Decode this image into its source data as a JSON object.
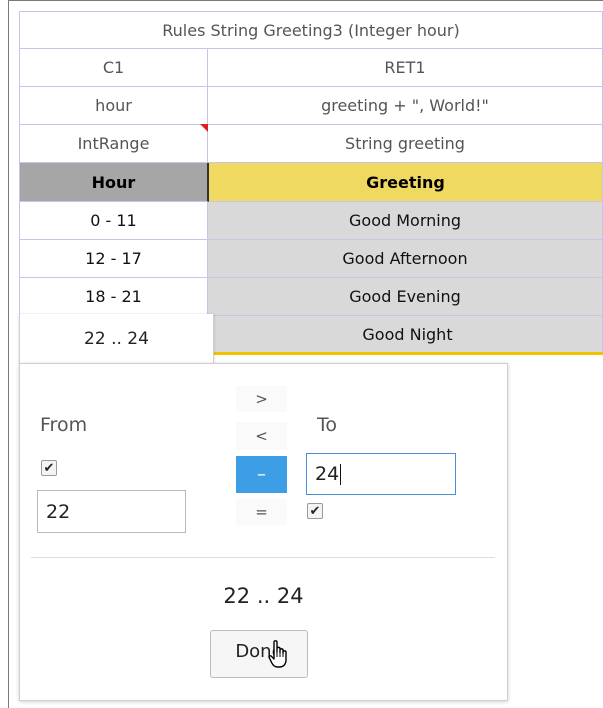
{
  "table": {
    "title": "Rules String Greeting3 (Integer hour)",
    "columns": [
      {
        "id": "C1",
        "param": "hour",
        "type": "IntRange",
        "header": "Hour"
      },
      {
        "id": "RET1",
        "param": "greeting + \", World!\"",
        "type": "String greeting",
        "header": "Greeting"
      }
    ],
    "rows": [
      {
        "condition": "0 - 11",
        "value": "Good Morning"
      },
      {
        "condition": "12 - 17",
        "value": "Good Afternoon"
      },
      {
        "condition": "18 - 21",
        "value": "Good Evening"
      },
      {
        "condition": "22 .. 24",
        "value": "Good Night"
      }
    ]
  },
  "range_editor": {
    "from_label": "From",
    "to_label": "To",
    "from_value": "22",
    "to_value": "24",
    "from_included": true,
    "to_included": true,
    "check_glyph": "✔",
    "operators": [
      ">",
      "<",
      "–",
      "="
    ],
    "active_operator": "–",
    "result_text": "22 .. 24",
    "done_label": "Done"
  },
  "colors": {
    "grid": "#c8c3ea",
    "header_hour_bg": "#a6a6a6",
    "header_greeting_bg": "#f0d960",
    "value_cell_bg": "#d9d9d9",
    "active_operator_bg": "#3d9ee6",
    "focus_border": "#4a8fd6",
    "accent_yellow": "#f2c200",
    "comment_marker": "#e02020"
  },
  "icons": {
    "cursor": "hand-pointer-icon",
    "comment_marker": "comment-indicator-icon",
    "checkbox": "checkmark-icon"
  }
}
